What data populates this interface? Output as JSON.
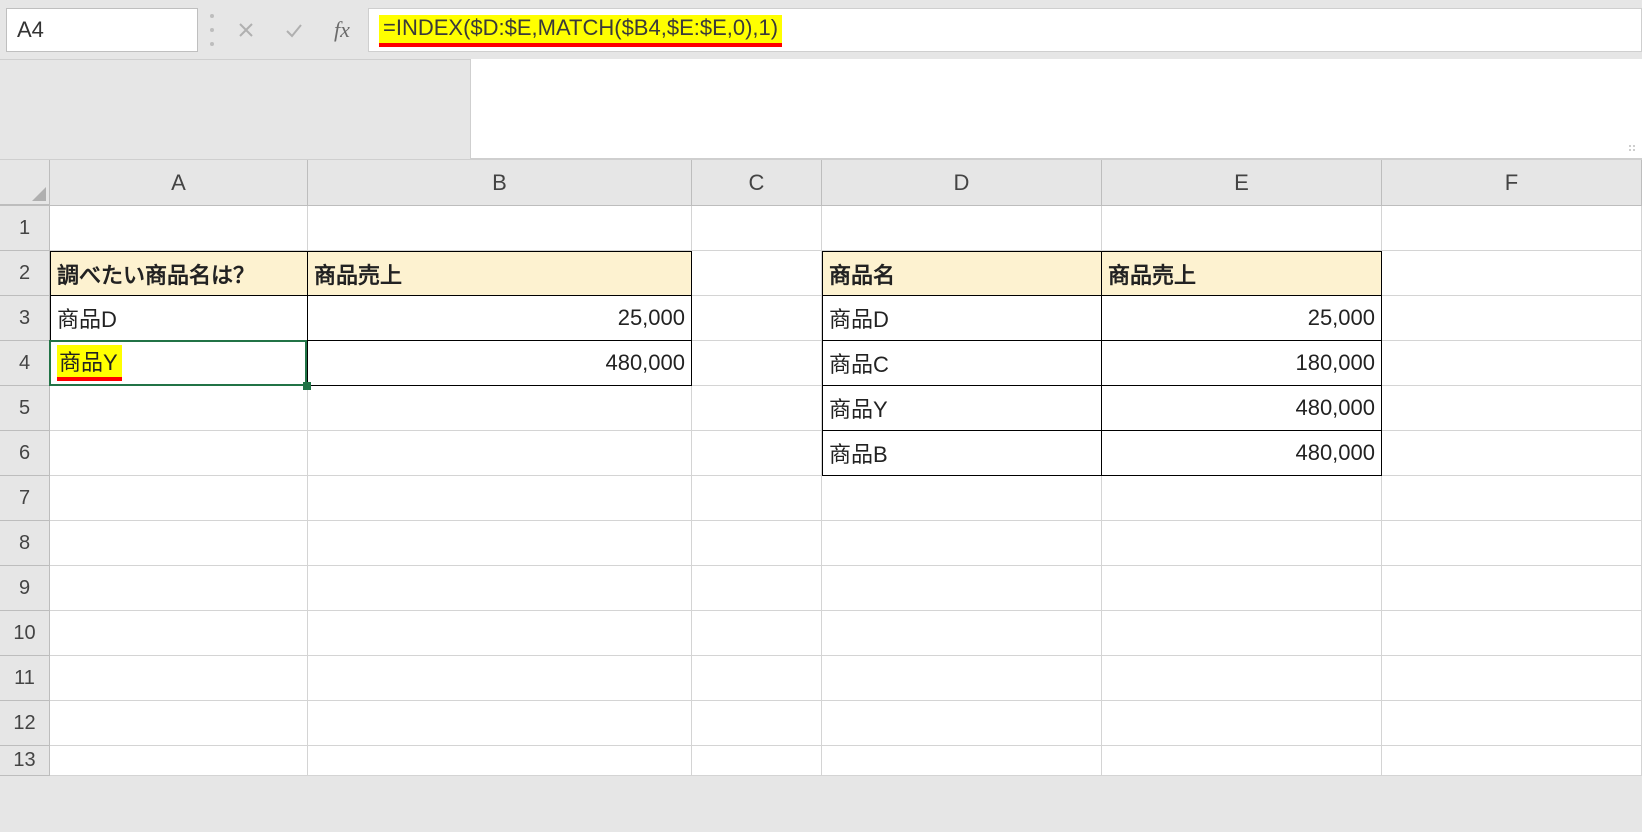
{
  "nameBox": {
    "value": "A4"
  },
  "formulaBar": {
    "formula": "=INDEX($D:$E,MATCH($B4,$E:$E,0),1)",
    "fxLabel": "fx"
  },
  "columns": [
    "A",
    "B",
    "C",
    "D",
    "E",
    "F"
  ],
  "rows": [
    "1",
    "2",
    "3",
    "4",
    "5",
    "6",
    "7",
    "8",
    "9",
    "10",
    "11",
    "12",
    "13"
  ],
  "sheet": {
    "A2": "調べたい商品名は？",
    "B2": "商品売上",
    "A3": "商品D",
    "B3": "25,000",
    "A4": "商品Y",
    "B4": "480,000",
    "D2": "商品名",
    "E2": "商品売上",
    "D3": "商品D",
    "E3": "25,000",
    "D4": "商品C",
    "E4": "180,000",
    "D5": "商品Y",
    "E5": "480,000",
    "D6": "商品B",
    "E6": "480,000"
  },
  "selection": {
    "cell": "A4"
  }
}
